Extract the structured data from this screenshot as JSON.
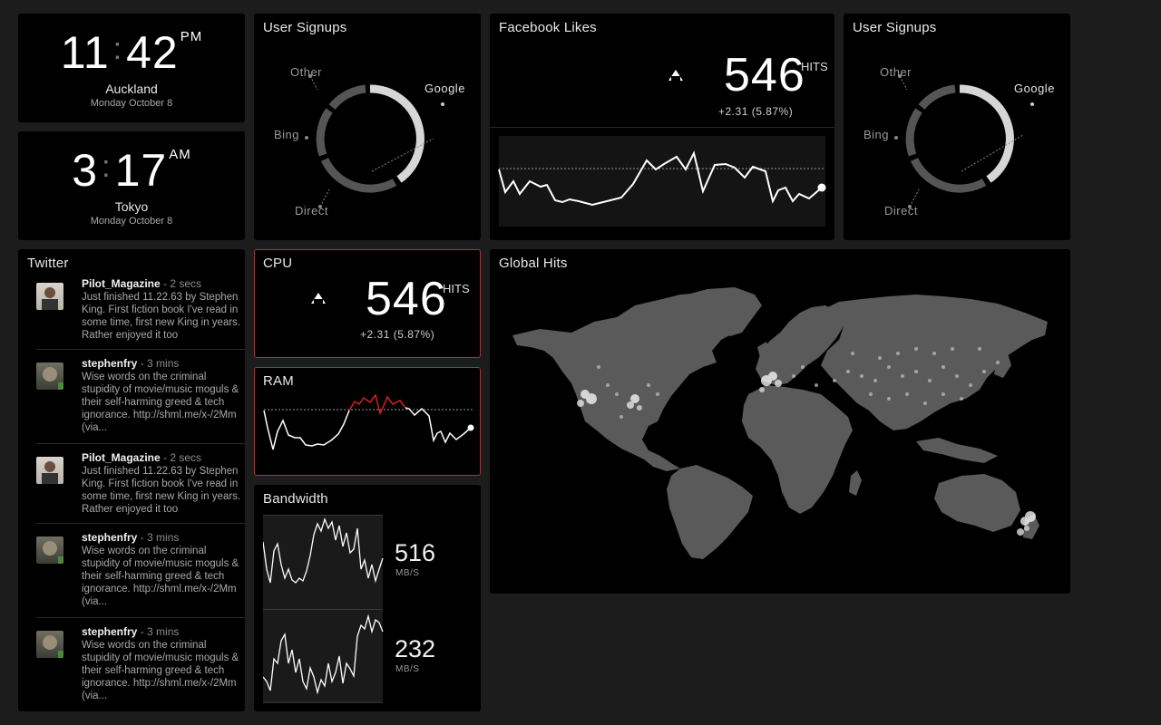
{
  "clocks": [
    {
      "hours": "11",
      "minutes": "42",
      "ampm": "PM",
      "city": "Auckland",
      "date": "Monday October 8"
    },
    {
      "hours": "3",
      "minutes": "17",
      "ampm": "AM",
      "city": "Tokyo",
      "date": "Monday October 8"
    }
  ],
  "signups_left": {
    "title": "User Signups",
    "labels": {
      "other": "Other",
      "google": "Google",
      "bing": "Bing",
      "direct": "Direct"
    }
  },
  "signups_right": {
    "title": "User Signups",
    "labels": {
      "other": "Other",
      "google": "Google",
      "bing": "Bing",
      "direct": "Direct"
    }
  },
  "facebook": {
    "title": "Facebook Likes",
    "value": "546",
    "unit": "HITS",
    "delta": "+2.31 (5.87%)"
  },
  "cpu": {
    "title": "CPU",
    "value": "546",
    "unit": "HITS",
    "delta": "+2.31 (5.87%)"
  },
  "ram": {
    "title": "RAM"
  },
  "bandwidth": {
    "title": "Bandwidth",
    "up_value": "516",
    "up_unit": "MB/S",
    "down_value": "232",
    "down_unit": "MB/S"
  },
  "global_hits": {
    "title": "Global Hits"
  },
  "twitter": {
    "title": "Twitter",
    "tweets": [
      {
        "user": "Pilot_Magazine",
        "time": " - 2 secs",
        "text": "Just finished 11.22.63 by Stephen King. First fiction book I've read in some time, first new King in years. Rather enjoyed it too"
      },
      {
        "user": "stephenfry",
        "time": " - 3 mins",
        "text": "Wise words on the criminal stupidity of movie/music moguls & their self-harming greed & tech ignorance. http://shml.me/x-/2Mm (via..."
      },
      {
        "user": "Pilot_Magazine",
        "time": " - 2 secs",
        "text": "Just finished 11.22.63 by Stephen King. First fiction book I've read in some time, first new King in years. Rather enjoyed it too"
      },
      {
        "user": "stephenfry",
        "time": " - 3 mins",
        "text": "Wise words on the criminal stupidity of movie/music moguls & their self-harming greed & tech ignorance. http://shml.me/x-/2Mm (via..."
      },
      {
        "user": "stephenfry",
        "time": " - 3 mins",
        "text": "Wise words on the criminal stupidity of movie/music moguls & their self-harming greed & tech ignorance. http://shml.me/x-/2Mm (via..."
      }
    ]
  },
  "colors": {
    "alert": "#d8201f",
    "panel": "#000000",
    "background": "#1c1c1c",
    "highlight": "#e0e0e0",
    "muted": "#555555"
  }
}
